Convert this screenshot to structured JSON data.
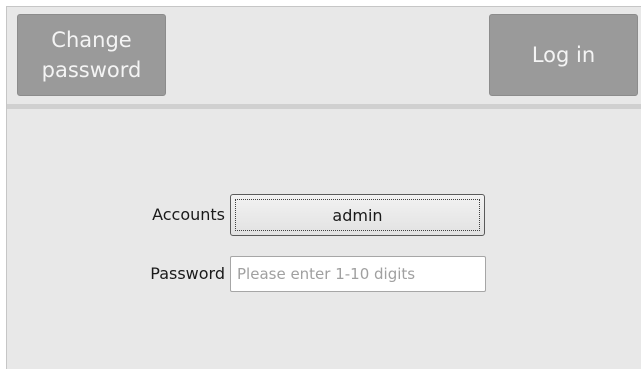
{
  "header": {
    "change_password_label": "Change password",
    "login_label": "Log in"
  },
  "form": {
    "accounts_label": "Accounts",
    "accounts_value": "admin",
    "password_label": "Password",
    "password_value": "",
    "password_placeholder": "Please enter 1-10 digits"
  },
  "colors": {
    "background": "#e8e8e8",
    "header_button": "#9a9a9a",
    "header_button_text": "#f4f4f4",
    "divider": "#d0d0d0"
  }
}
